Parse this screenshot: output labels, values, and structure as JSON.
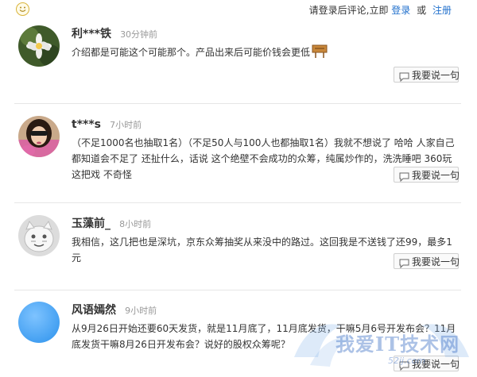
{
  "header": {
    "prompt": "请登录后评论,立即",
    "login": "登录",
    "or": "或",
    "register": "注册"
  },
  "comments": [
    {
      "user": "利***铁",
      "time": "30分钟前",
      "text": "介绍都是可能这个可能那个。产品出来后可能价钱会更低"
    },
    {
      "user": "t***s",
      "time": "7小时前",
      "text": "（不足1000名也抽取1名）（不足50人与100人也都抽取1名）我就不想说了 哈哈 人家自己都知道会不足了 还扯什么，话说 这个绝壁不会成功的众筹，纯属炒作的，洗洗睡吧 360玩这把戏 不奇怪"
    },
    {
      "user": "玉藻前_",
      "time": "8小时前",
      "text": "我相信，这几把也是深坑，京东众筹抽奖从来没中的路过。这回我是不送钱了还99，最多1元"
    },
    {
      "user": "风语嫣然",
      "time": "9小时前",
      "text": "从9月26日开始还要60天发货，就是11月底了，11月底发货，干嘛5月6号开发布会？11月底发货干嘛8月26日开发布会？说好的股权众筹呢？"
    }
  ],
  "reply_label": "我要说一句",
  "watermark": {
    "title": "我爱IT技术网",
    "url": "52ij.com"
  },
  "icons": {
    "smile": "smile-icon",
    "reply": "comment-icon",
    "sign": "sign-icon"
  },
  "colors": {
    "link": "#1f6fcc",
    "time": "#999999",
    "divider": "#e6e6e6"
  }
}
